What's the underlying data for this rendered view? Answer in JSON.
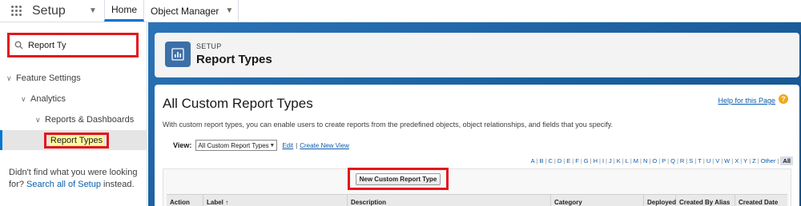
{
  "topnav": {
    "app_name": "Setup",
    "tabs": [
      {
        "label": "Home"
      },
      {
        "label": "Object Manager"
      }
    ]
  },
  "sidebar": {
    "search_value": "Report Ty",
    "tree": [
      {
        "label": "Feature Settings"
      },
      {
        "label": "Analytics"
      },
      {
        "label": "Reports & Dashboards"
      },
      {
        "label": "Report Types"
      }
    ],
    "not_found_text": "Didn't find what you were looking for?",
    "search_all_link": "Search all of Setup",
    "not_found_suffix": "instead."
  },
  "header": {
    "eyebrow": "SETUP",
    "title": "Report Types"
  },
  "content": {
    "h1": "All Custom Report Types",
    "help_link": "Help for this Page",
    "intro": "With custom report types, you can enable users to create reports from the predefined objects, object relationships, and fields that you specify.",
    "view_label": "View:",
    "view_selected": "All Custom Report Types",
    "edit_link": "Edit",
    "create_view_link": "Create New View",
    "alpha": [
      "A",
      "B",
      "C",
      "D",
      "E",
      "F",
      "G",
      "H",
      "I",
      "J",
      "K",
      "L",
      "M",
      "N",
      "O",
      "P",
      "Q",
      "R",
      "S",
      "T",
      "U",
      "V",
      "W",
      "X",
      "Y",
      "Z",
      "Other"
    ],
    "alpha_all": "All",
    "new_button": "New Custom Report Type",
    "columns": [
      {
        "label": "Action"
      },
      {
        "label": "Label ↑"
      },
      {
        "label": "Description"
      },
      {
        "label": "Category"
      },
      {
        "label": "Deployed"
      },
      {
        "label": "Created By Alias"
      },
      {
        "label": "Created Date"
      }
    ]
  },
  "colors": {
    "brand_blue": "#0176d3",
    "highlight_red": "#e3161b",
    "background_blue": "#1b5f9e",
    "help_icon": "#f0a919"
  }
}
